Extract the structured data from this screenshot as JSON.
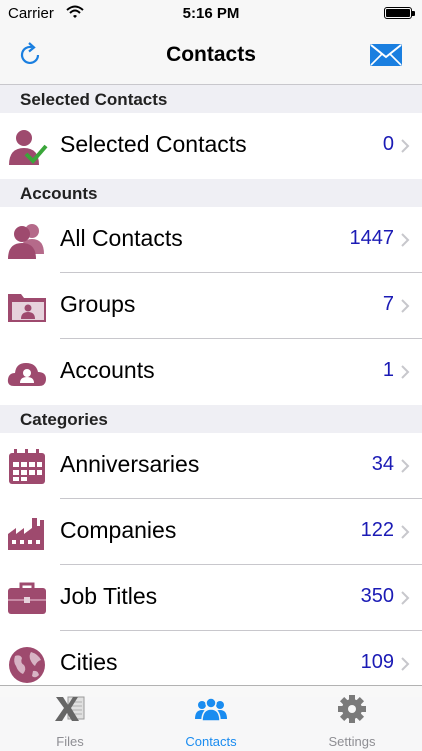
{
  "status_bar": {
    "carrier": "Carrier",
    "time": "5:16 PM"
  },
  "nav": {
    "title": "Contacts"
  },
  "sections": {
    "selected": {
      "header": "Selected Contacts",
      "rows": [
        {
          "label": "Selected Contacts",
          "count": "0"
        }
      ]
    },
    "accounts": {
      "header": "Accounts",
      "rows": [
        {
          "label": "All Contacts",
          "count": "1447"
        },
        {
          "label": "Groups",
          "count": "7"
        },
        {
          "label": "Accounts",
          "count": "1"
        }
      ]
    },
    "categories": {
      "header": "Categories",
      "rows": [
        {
          "label": "Anniversaries",
          "count": "34"
        },
        {
          "label": "Companies",
          "count": "122"
        },
        {
          "label": "Job Titles",
          "count": "350"
        },
        {
          "label": "Cities",
          "count": "109"
        }
      ]
    }
  },
  "tabs": [
    {
      "label": "Files",
      "icon": "excel-x-icon"
    },
    {
      "label": "Contacts",
      "icon": "people-icon",
      "active": true
    },
    {
      "label": "Settings",
      "icon": "gear-icon"
    }
  ],
  "colors": {
    "accent": "#1a8cf0",
    "count": "#1b1bb5",
    "icon": "#9e4a6e"
  }
}
